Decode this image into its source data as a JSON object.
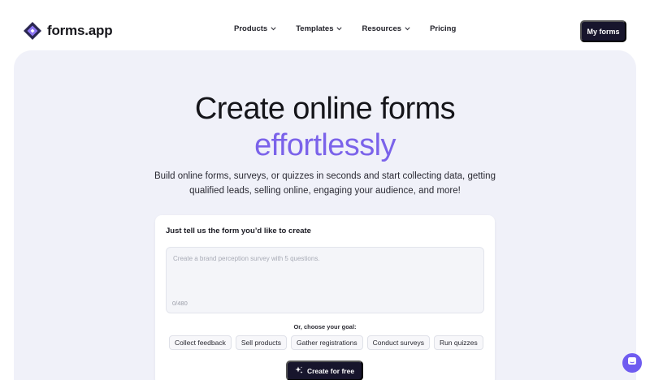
{
  "brand": {
    "name": "forms.app",
    "logo_icon": "forms-app-logo-icon",
    "accent": "#7b63ea",
    "dark": "#17152c"
  },
  "nav": {
    "items": [
      {
        "label": "Products",
        "dropdown": true
      },
      {
        "label": "Templates",
        "dropdown": true
      },
      {
        "label": "Resources",
        "dropdown": true
      },
      {
        "label": "Pricing",
        "dropdown": false
      }
    ],
    "my_forms_label": "My forms"
  },
  "hero": {
    "title_line1": "Create online forms",
    "title_line2": "effortlessly",
    "subtitle": "Build online forms, surveys, or quizzes in seconds and start collecting data, getting qualified leads, selling online, engaging your audience, and more!"
  },
  "form_card": {
    "label": "Just tell us the form you’d like to create",
    "input_placeholder": "Create a brand perception survey with 5 questions.",
    "input_value": "",
    "counter": "0/480",
    "goal_label": "Or, choose your goal:",
    "goals": [
      "Collect feedback",
      "Sell products",
      "Gather registrations",
      "Conduct surveys",
      "Run quizzes"
    ],
    "create_label": "Create for free",
    "create_icon": "sparkle-icon"
  },
  "chat": {
    "icon": "chat-icon",
    "color": "#6f5cf0"
  }
}
